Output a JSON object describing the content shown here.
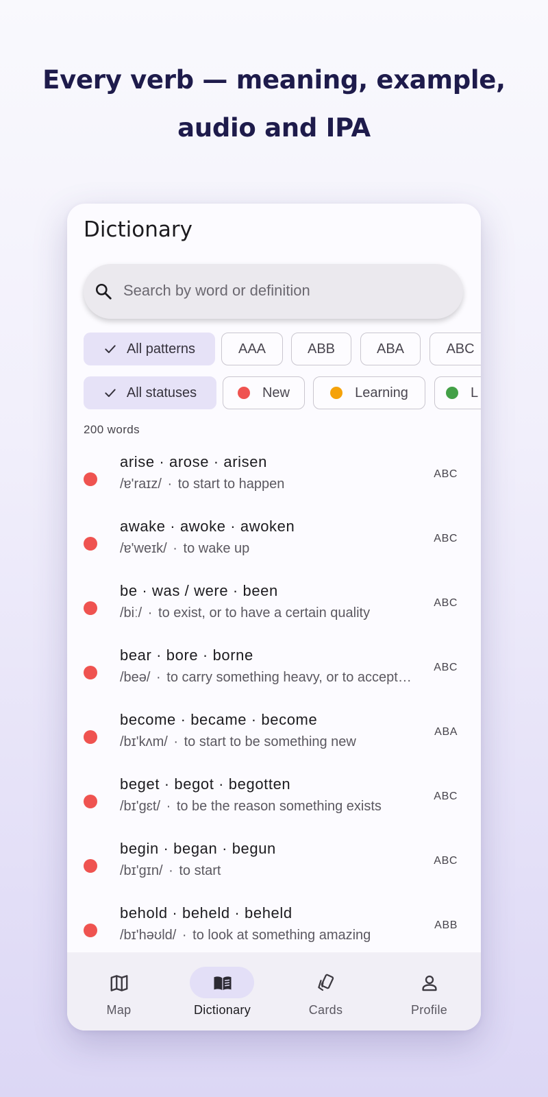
{
  "headline": {
    "line1": "Every verb — meaning, example,",
    "line2": "audio and IPA"
  },
  "screen": {
    "title": "Dictionary"
  },
  "search": {
    "placeholder": "Search by word or definition",
    "icon": "search-icon"
  },
  "pattern_filters": [
    {
      "label": "All patterns",
      "selected": true
    },
    {
      "label": "AAA",
      "selected": false
    },
    {
      "label": "ABB",
      "selected": false
    },
    {
      "label": "ABA",
      "selected": false
    },
    {
      "label": "ABC",
      "selected": false
    }
  ],
  "status_filters": [
    {
      "label": "All statuses",
      "selected": true
    },
    {
      "label": "New",
      "color": "#ef5350"
    },
    {
      "label": "Learning",
      "color": "#f5a20a"
    },
    {
      "label": "L",
      "color": "#43a047"
    }
  ],
  "word_count": "200 words",
  "status_colors": {
    "new": "#ef5350"
  },
  "words": [
    {
      "forms": "arise · arose · arisen",
      "ipa": "/ɐ'raɪz/",
      "meaning": "to start to happen",
      "pattern": "ABC",
      "status": "new"
    },
    {
      "forms": "awake · awoke · awoken",
      "ipa": "/ɐ'weɪk/",
      "meaning": "to wake up",
      "pattern": "ABC",
      "status": "new"
    },
    {
      "forms": "be · was / were · been",
      "ipa": "/biː/",
      "meaning": "to exist, or to have a certain quality",
      "pattern": "ABC",
      "status": "new"
    },
    {
      "forms": "bear · bore · borne",
      "ipa": "/beə/",
      "meaning": "to carry something heavy, or to accept something difficult",
      "pattern": "ABC",
      "status": "new"
    },
    {
      "forms": "become · became · become",
      "ipa": "/bɪ'kʌm/",
      "meaning": "to start to be something new",
      "pattern": "ABA",
      "status": "new"
    },
    {
      "forms": "beget · begot · begotten",
      "ipa": "/bɪ'gɛt/",
      "meaning": "to be the reason something exists",
      "pattern": "ABC",
      "status": "new"
    },
    {
      "forms": "begin · began · begun",
      "ipa": "/bɪ'gɪn/",
      "meaning": "to start",
      "pattern": "ABC",
      "status": "new"
    },
    {
      "forms": "behold · beheld · beheld",
      "ipa": "/bɪ'həʊld/",
      "meaning": "to look at something amazing",
      "pattern": "ABB",
      "status": "new"
    }
  ],
  "separator": " · ",
  "bottom_nav": [
    {
      "label": "Map",
      "icon": "map-icon",
      "active": false
    },
    {
      "label": "Dictionary",
      "icon": "book-icon",
      "active": true
    },
    {
      "label": "Cards",
      "icon": "cards-icon",
      "active": false
    },
    {
      "label": "Profile",
      "icon": "profile-icon",
      "active": false
    }
  ]
}
